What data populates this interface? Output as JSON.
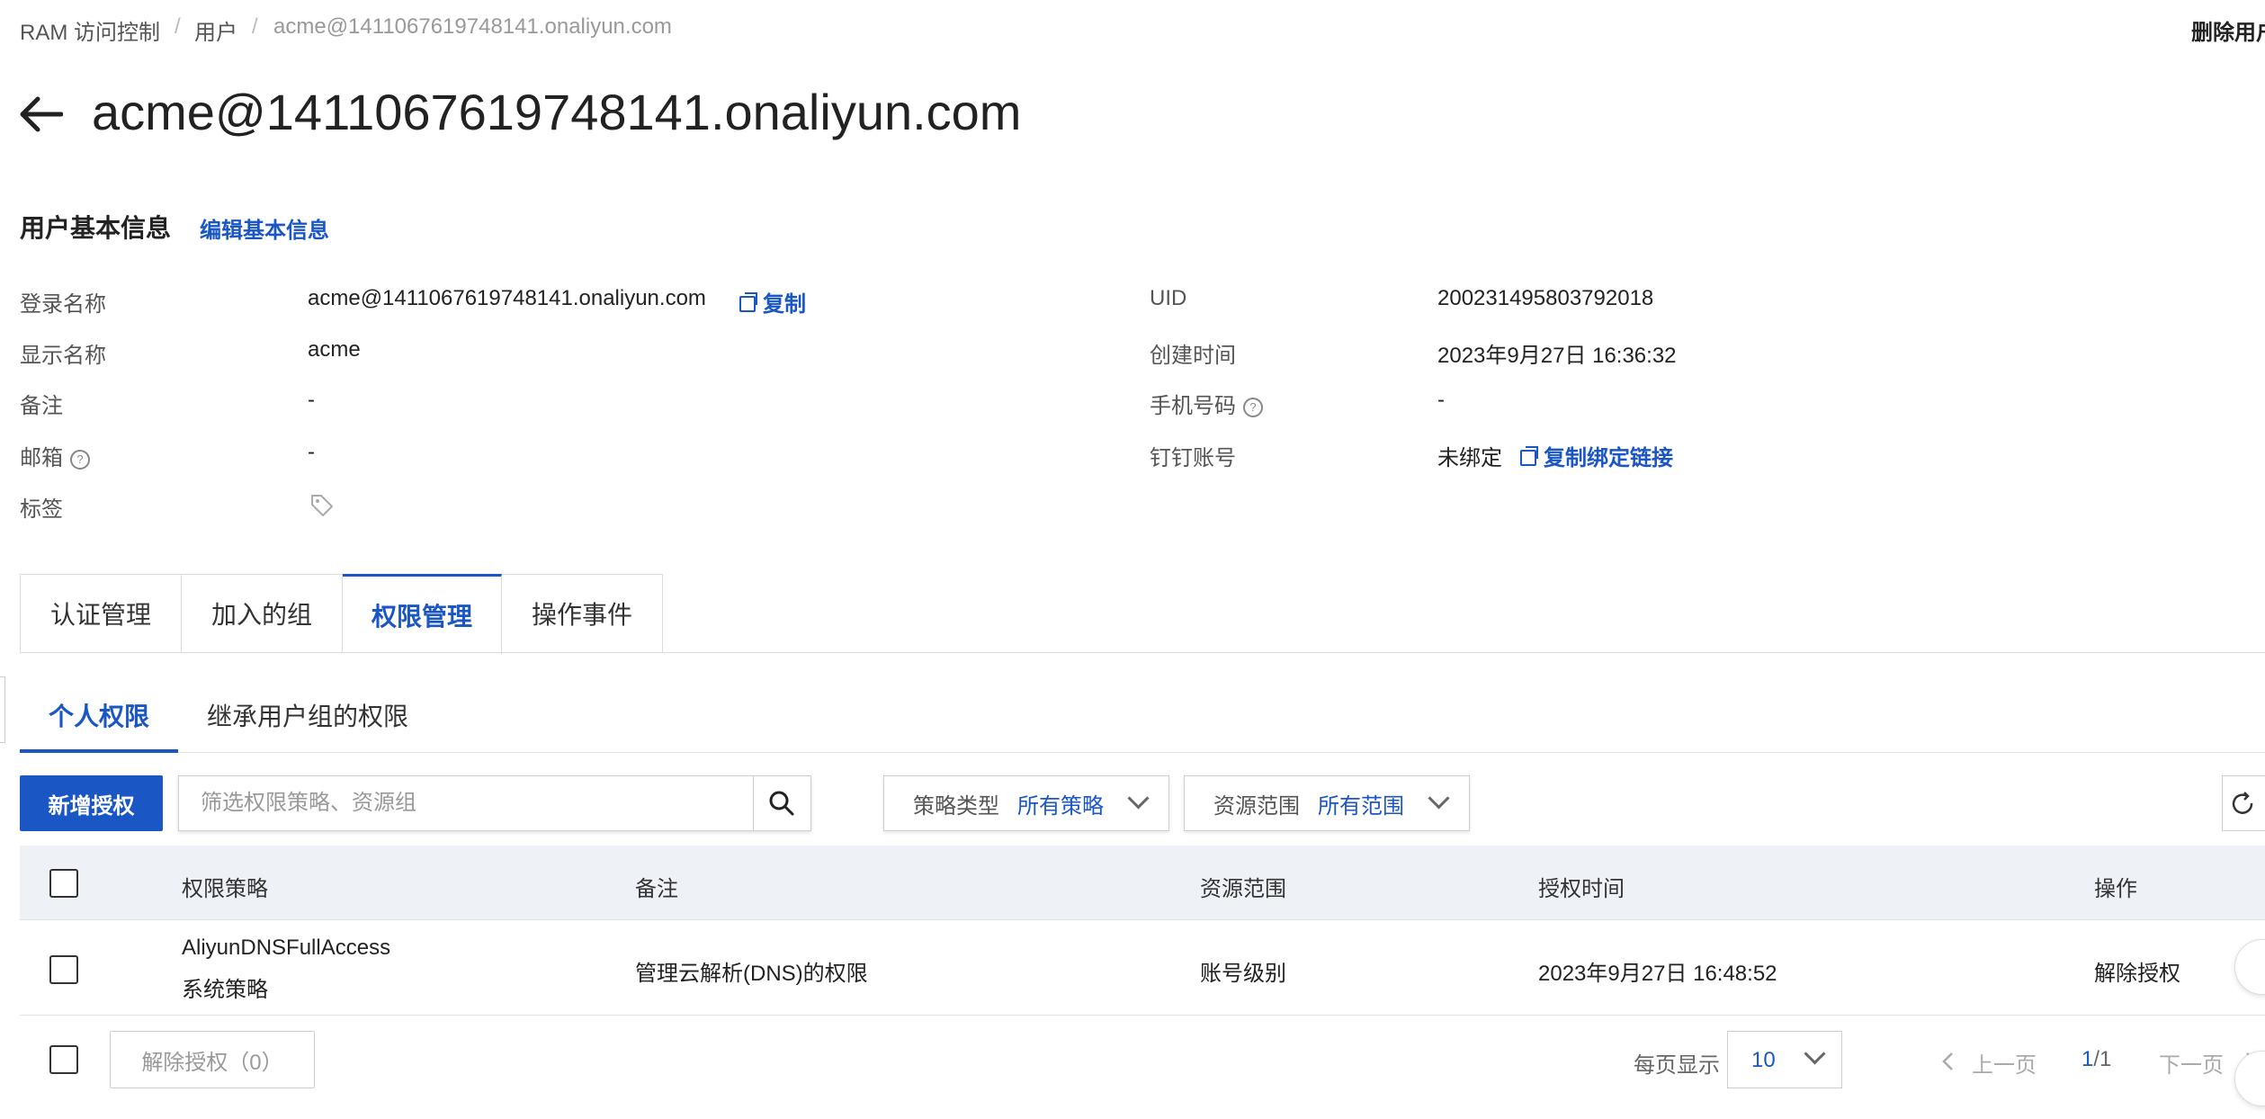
{
  "breadcrumb": [
    "RAM 访问控制",
    "用户",
    "acme@1411067619748141.onaliyun.com"
  ],
  "breadcrumb_sep": "/",
  "header": {
    "title": "acme@1411067619748141.onaliyun.com",
    "delete_user": "删除用户"
  },
  "basic_info": {
    "section_title": "用户基本信息",
    "edit_link": "编辑基本信息",
    "login_name": {
      "label": "登录名称",
      "value": "acme@1411067619748141.onaliyun.com",
      "copy": "复制"
    },
    "display_name": {
      "label": "显示名称",
      "value": "acme"
    },
    "remark": {
      "label": "备注",
      "value": "-"
    },
    "email": {
      "label": "邮箱",
      "value": "-"
    },
    "tags": {
      "label": "标签"
    },
    "uid": {
      "label": "UID",
      "value": "200231495803792018"
    },
    "created": {
      "label": "创建时间",
      "value": "2023年9月27日 16:36:32"
    },
    "phone": {
      "label": "手机号码",
      "value": "-"
    },
    "dingtalk": {
      "label": "钉钉账号",
      "value": "未绑定",
      "copy_link": "复制绑定链接"
    },
    "help_glyph": "?"
  },
  "tabs": [
    "认证管理",
    "加入的组",
    "权限管理",
    "操作事件"
  ],
  "active_tab": "权限管理",
  "subtabs": [
    "个人权限",
    "继承用户组的权限"
  ],
  "toolbar": {
    "add_grant": "新增授权",
    "search_placeholder": "筛选权限策略、资源组",
    "policy_type_label": "策略类型",
    "policy_type_value": "所有策略",
    "scope_label": "资源范围",
    "scope_value": "所有范围"
  },
  "table": {
    "columns": [
      "权限策略",
      "备注",
      "资源范围",
      "授权时间",
      "操作"
    ],
    "rows": [
      {
        "policy": "AliyunDNSFullAccess",
        "policy_type": "系统策略",
        "remark": "管理云解析(DNS)的权限",
        "scope": "账号级别",
        "time": "2023年9月27日 16:48:52",
        "action": "解除授权"
      }
    ]
  },
  "footer": {
    "bulk_revoke": "解除授权（0）",
    "per_page_label": "每页显示",
    "per_page_value": "10",
    "prev": "上一页",
    "page_current": "1",
    "page_total": "/1",
    "next": "下一页"
  },
  "colors": {
    "accent": "#1a56c4",
    "header_bg": "#eef1f6"
  },
  "icons": [
    "back-arrow-icon",
    "copy-icon",
    "help-icon",
    "tag-icon",
    "search-icon",
    "chevron-down-icon",
    "refresh-icon",
    "chevron-left-icon",
    "chevron-right-icon"
  ]
}
